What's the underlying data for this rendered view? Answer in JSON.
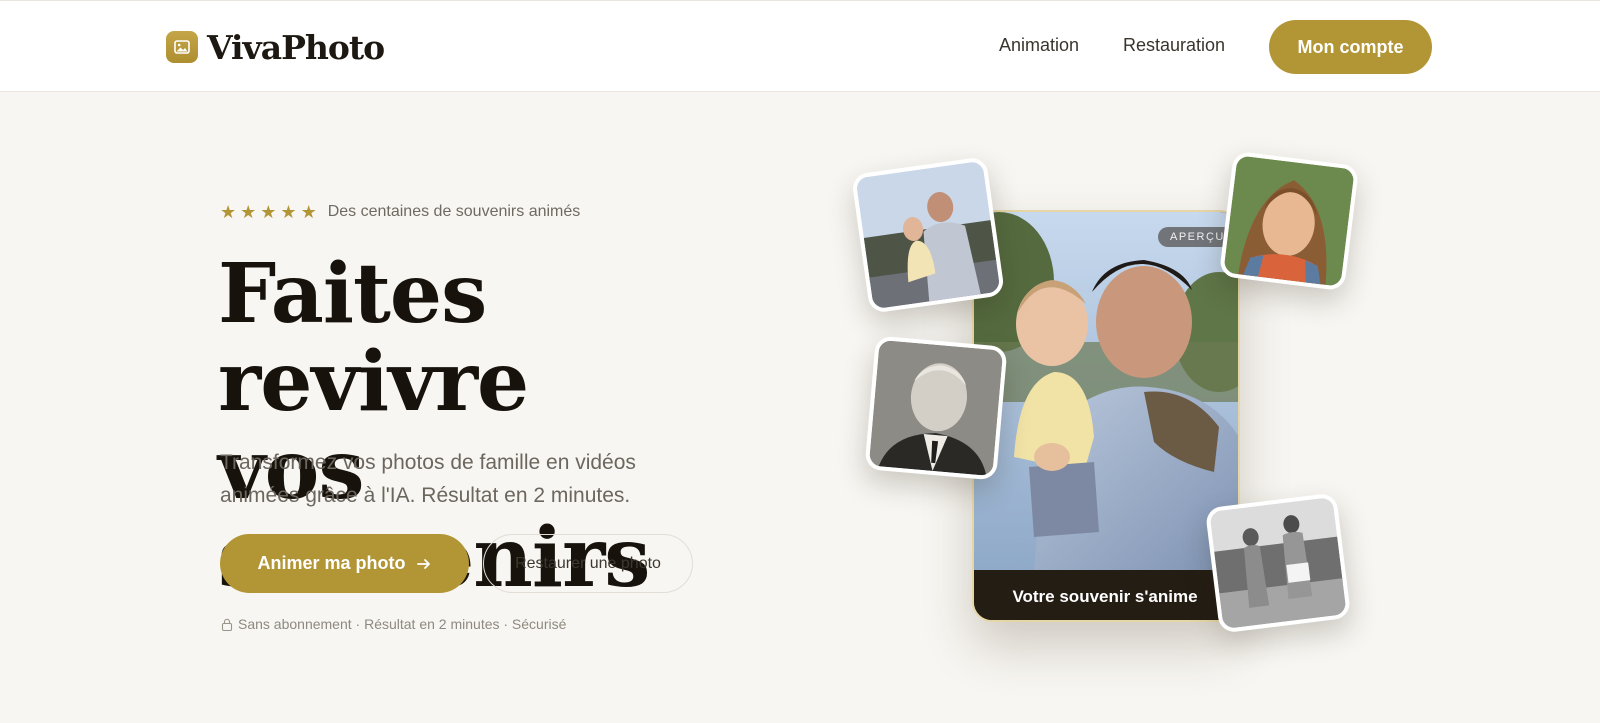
{
  "header": {
    "brand": "VivaPhoto",
    "nav": [
      {
        "label": "Animation"
      },
      {
        "label": "Restauration"
      }
    ],
    "account_button": "Mon compte"
  },
  "hero": {
    "rating": {
      "stars": 5,
      "text": "Des centaines de souvenirs animés"
    },
    "headline_line1": "Faites revivre",
    "headline_line2": "vos souvenirs",
    "subtitle": "Transformez vos photos de famille en vidéos animées grâce à l'IA. Résultat en 2 minutes.",
    "primary_button": "Animer ma photo",
    "secondary_button": "Restaurer une photo",
    "trust_line": "Sans abonnement · Résultat en 2 minutes · Sécurisé"
  },
  "preview": {
    "badge": "APERÇU",
    "caption": "Votre souvenir s'anime"
  },
  "colors": {
    "accent": "#b29636",
    "background": "#f8f6f2",
    "header_bg": "#ffffff",
    "text_dark": "#17130c",
    "text_muted": "#6c675e",
    "caption_bg": "#241d14"
  },
  "icons": {
    "logo": "image-icon",
    "star": "star-icon",
    "arrow": "arrow-right-icon",
    "lock": "lock-icon"
  }
}
